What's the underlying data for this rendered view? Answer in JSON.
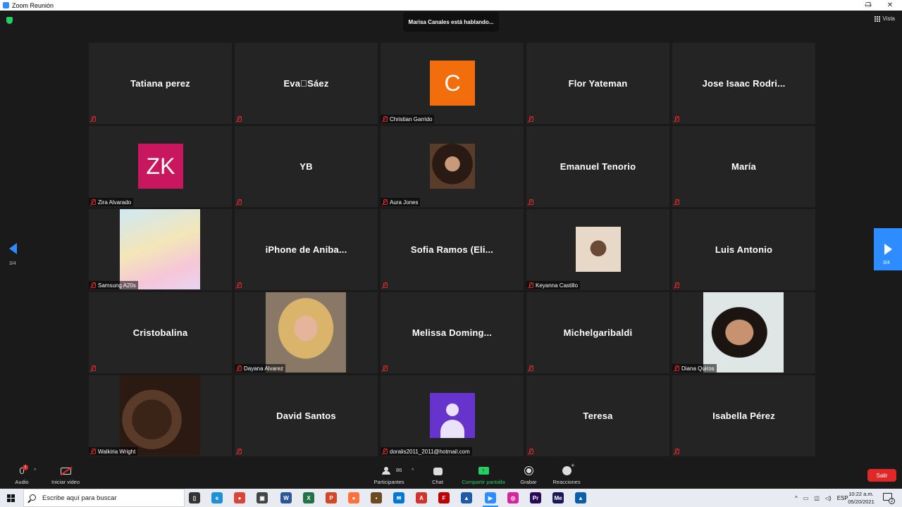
{
  "window": {
    "title": "Zoom Reunión",
    "minimize": "—",
    "maximize": "❐",
    "close": "✕"
  },
  "meeting": {
    "speaking_banner": "Marisa Canales está hablando...",
    "view_label": "Vista",
    "security_icon": "shield-icon"
  },
  "pagination": {
    "left_page": "3/4",
    "right_page": "3/4"
  },
  "participants": [
    {
      "name": "Tatiana perez",
      "display": "name",
      "label": ""
    },
    {
      "name": "Eva\u0000Sáez",
      "display": "name",
      "label": ""
    },
    {
      "name": "Christian Garrido",
      "display": "initial",
      "initial": "C",
      "color": "#f26d0c",
      "label": "Christian Garrido"
    },
    {
      "name": "Flor Yateman",
      "display": "name",
      "label": ""
    },
    {
      "name": "Jose Isaac Rodri...",
      "display": "name",
      "label": ""
    },
    {
      "name": "Zira Alvarado",
      "display": "initial",
      "initial": "ZK",
      "color": "#c8175f",
      "label": "Zira Alvarado"
    },
    {
      "name": "YB",
      "display": "name",
      "label": ""
    },
    {
      "name": "Aura Jones",
      "display": "photo-small",
      "photo": "woman-dark-hair",
      "label": "Aura Jones"
    },
    {
      "name": "Emanuel Tenorio",
      "display": "name",
      "label": ""
    },
    {
      "name": "María",
      "display": "name",
      "label": ""
    },
    {
      "name": "Samsung A20s",
      "display": "photo",
      "photo": "greeting-card",
      "label": "Samsung A20s"
    },
    {
      "name": "iPhone de Aniba...",
      "display": "name",
      "label": ""
    },
    {
      "name": "Sofia Ramos (Eli...",
      "display": "name",
      "label": ""
    },
    {
      "name": "Keyanna Castillo",
      "display": "photo-small",
      "photo": "woman-portrait",
      "label": "Keyanna Castillo"
    },
    {
      "name": "Luis Antonio",
      "display": "name",
      "label": ""
    },
    {
      "name": "Cristobalina",
      "display": "name",
      "label": ""
    },
    {
      "name": "Dayana Alvarez",
      "display": "photo",
      "photo": "blonde-woman",
      "label": "Dayana Alvarez"
    },
    {
      "name": "Melissa Doming...",
      "display": "name",
      "label": ""
    },
    {
      "name": "Michelgaribaldi",
      "display": "name",
      "label": ""
    },
    {
      "name": "Diana Quiros",
      "display": "photo",
      "photo": "smiling-woman",
      "label": "Diana Quiros"
    },
    {
      "name": "Walkiria Wright",
      "display": "photo",
      "photo": "mother-child",
      "label": "Walkiria Wright"
    },
    {
      "name": "David Santos",
      "display": "name",
      "label": ""
    },
    {
      "name": "doralis2011_2011@hotmail.com",
      "display": "generic",
      "color": "#6633cc",
      "label": "doralis2011_2011@hotmail.com"
    },
    {
      "name": "Teresa",
      "display": "name",
      "label": ""
    },
    {
      "name": "Isabella Pérez",
      "display": "name",
      "label": ""
    }
  ],
  "toolbar": {
    "audio": "Audio",
    "audio_badge": "!",
    "video": "Iniciar video",
    "participants": "Participantes",
    "participants_count": "86",
    "chat": "Chat",
    "share": "Compartir pantalla",
    "record": "Grabar",
    "reactions": "Reacciones",
    "leave": "Salir",
    "caret": "^",
    "share_arrow": "↑"
  },
  "taskbar": {
    "search_placeholder": "Escribe aquí para buscar",
    "language": "ESP",
    "time": "10:22 a.m.",
    "date": "05/20/2021",
    "notification_count": "2",
    "apps": [
      {
        "name": "task-view",
        "color": "#333333",
        "glyph": "▯"
      },
      {
        "name": "edge",
        "color": "#1f8fd6",
        "glyph": "e"
      },
      {
        "name": "chrome",
        "color": "#db4437",
        "glyph": "●"
      },
      {
        "name": "store",
        "color": "#444444",
        "glyph": "▣"
      },
      {
        "name": "word",
        "color": "#2b579a",
        "glyph": "W"
      },
      {
        "name": "excel",
        "color": "#217346",
        "glyph": "X"
      },
      {
        "name": "powerpoint",
        "color": "#d24726",
        "glyph": "P"
      },
      {
        "name": "firefox",
        "color": "#ff7139",
        "glyph": "●"
      },
      {
        "name": "app-brown",
        "color": "#6b4a1f",
        "glyph": "▪"
      },
      {
        "name": "mail",
        "color": "#0078d4",
        "glyph": "✉"
      },
      {
        "name": "acrobat",
        "color": "#d1342b",
        "glyph": "A"
      },
      {
        "name": "filezilla",
        "color": "#bf0000",
        "glyph": "F"
      },
      {
        "name": "app-blue",
        "color": "#1e5aa8",
        "glyph": "▲"
      },
      {
        "name": "zoom",
        "color": "#2d8cff",
        "glyph": "▶"
      },
      {
        "name": "instagram",
        "color": "#d6249f",
        "glyph": "◎"
      },
      {
        "name": "premiere",
        "color": "#2a0a56",
        "glyph": "Pr"
      },
      {
        "name": "media-encoder",
        "color": "#1b1656",
        "glyph": "Me"
      },
      {
        "name": "photos",
        "color": "#0a5fa8",
        "glyph": "▲"
      }
    ]
  },
  "colors": {
    "accent": "#2d8cff",
    "danger": "#e02828",
    "share_green": "#23d160",
    "tile_bg": "#242424"
  }
}
